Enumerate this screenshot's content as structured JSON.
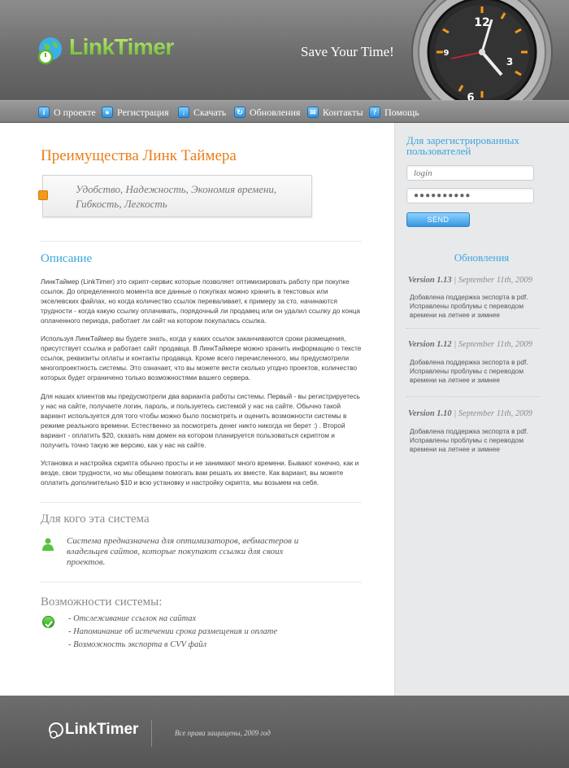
{
  "header": {
    "logo_text": "LinkTimer",
    "tagline": "Save Your Time!",
    "clock_numbers": [
      "12",
      "3",
      "6",
      "9"
    ]
  },
  "nav": {
    "items": [
      {
        "label": "О проекте",
        "icon": "info-icon"
      },
      {
        "label": "Регистрация",
        "icon": "user-icon"
      },
      {
        "label": "Скачать",
        "icon": "download-icon"
      },
      {
        "label": "Обновления",
        "icon": "refresh-icon"
      },
      {
        "label": "Контакты",
        "icon": "mail-icon"
      },
      {
        "label": "Помощь",
        "icon": "help-icon"
      }
    ]
  },
  "main": {
    "title": "Преимущества Линк Таймера",
    "features": "Удобство, Надежность, Экономия времени, Гибкость, Легкость",
    "description_heading": "Описание",
    "paragraphs": [
      "ЛинкТаймер (LinkTimer) это скрипт-сервис которые позволяет оптимизировать работу при покупке ссылок. До определенного момента все данные о покупках можно хранить в текстовых или экселевских файлах, но когда количество ссылок переваливает, к примеру за сто, начинаются трудности - когда какую ссылку оплачивать, порядочный ли продавец или он удалил ссылку до конца оплаченного периода, работает ли сайт на котором покупалась ссылка.",
      "Используя ЛинкТаймер вы будете знать, когда у каких ссылок заканчиваются сроки размещения, присутствует ссылка и работает сайт продавца. В ЛинкТаймере можно хранить информацию о тексте ссылок, реквизиты оплаты и контакты продавца. Кроме всего перечисленного, мы предусмотрели многопроектность системы. Это означает, что вы можете вести сколько угодно проектов, количество которых будет ограничено только возможностями вашего сервера.",
      "Для наших клиентов мы предусмотрели два варианта работы системы. Первый - вы регистрируетесь у нас на сайте, получаете логин, пароль, и пользуетесь системой у нас на сайте. Обычно такой вариант используется для того чтобы можно было посмотреть и оценить возможности системы в режиме реального времени. Естественно за посмотреть денег никто никогда не берет :) . Второй вариант - оплатить $20, сказать нам домен на котором планируется пользоваться скриптом и получить точно такую же версию, как у нас на сайте.",
      "Установка и настройка скрипта обычно просты и не занимают много времени. Бывают конечно, как и везде, свои трудности, но мы обещаем помогать вам решать их вместе. Как вариант, вы можете оплатить дополнительно $10 и всю установку и настройку скрипта, мы возьмем на себя."
    ],
    "who_heading": "Для кого эта система",
    "who_text": "Система предназначена для оптимизаторов, вебмастеров и владельцев сайтов, которые покупают ссылки для своих проектов.",
    "capabilities_heading": "Возможности системы:",
    "capabilities": [
      "- Отслеживание ссылок на сайтах",
      "- Напоминание об истечении срока размещения и оплате",
      "- Возможность экспорта в CVV файл"
    ]
  },
  "sidebar": {
    "registered_heading": "Для зарегистрированных пользователей",
    "login_placeholder": "login",
    "password_value": "●●●●●●●●●●",
    "send_label": "SEND",
    "updates_heading": "Обновления",
    "updates": [
      {
        "version": "Version 1.13",
        "date": " | September 11th, 2009",
        "note": "Добавлена поддержка экспорта в pdf. Исправлены проблумы с переводом времени на летнее и зимнее"
      },
      {
        "version": "Version 1.12",
        "date": " | September 11th, 2009",
        "note": "Добавлена поддержка экспорта в pdf. Исправлены проблумы с переводом времени на летнее и зимнее"
      },
      {
        "version": "Version 1.10",
        "date": " | September 11th, 2009",
        "note": "Добавлена поддержка экспорта в pdf. Исправлены проблумы с переводом времени на летнее и зимнее"
      }
    ]
  },
  "footer": {
    "logo_text": "LinkTimer",
    "copyright": "Все права защищены, 2009 год"
  },
  "colors": {
    "accent_orange": "#e87e1a",
    "accent_blue": "#3ba5dc",
    "logo_green": "#7bc043"
  }
}
